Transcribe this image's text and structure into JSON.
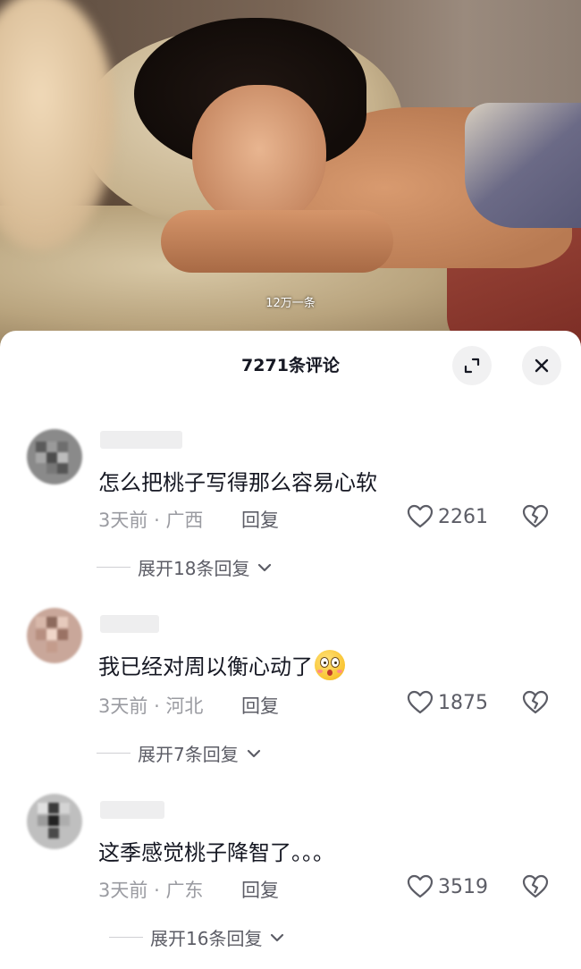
{
  "video": {
    "subtitle": "12万一条"
  },
  "sheet": {
    "title": "7271条评论"
  },
  "comments": [
    {
      "text": "怎么把桃子写得那么容易心软",
      "time": "3天前",
      "sep": "·",
      "location": "广西",
      "reply_label": "回复",
      "likes": "2261",
      "expand_label": "展开18条回复"
    },
    {
      "text": "我已经对周以衡心动了",
      "emoji": "flushed-face-emoji",
      "time": "3天前",
      "sep": "·",
      "location": "河北",
      "reply_label": "回复",
      "likes": "1875",
      "expand_label": "展开7条回复"
    },
    {
      "text": "这季感觉桃子降智了。。。",
      "time": "3天前",
      "sep": "·",
      "location": "广东",
      "reply_label": "回复",
      "likes": "3519",
      "expand_label": "展开16条回复"
    }
  ],
  "icons": {
    "expand": "expand-icon",
    "close": "close-icon",
    "like": "heart-icon",
    "dislike": "broken-heart-icon",
    "chevron": "chevron-down-icon"
  },
  "colors": {
    "text_primary": "#161823",
    "text_secondary": "#9a9ba1",
    "text_action": "#5c5d66",
    "sheet_bg": "#ffffff"
  }
}
